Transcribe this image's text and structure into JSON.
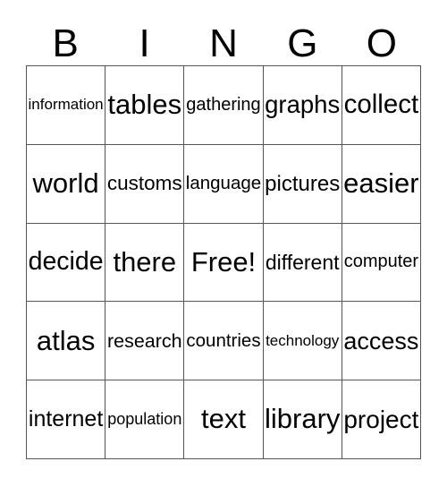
{
  "card": {
    "header_letters": [
      "B",
      "I",
      "N",
      "G",
      "O"
    ],
    "free_space_label": "Free!",
    "colors": {
      "text": "#000000",
      "grid_line": "#555555",
      "background": "#ffffff"
    },
    "rows": [
      [
        {
          "text": "information"
        },
        {
          "text": "tables"
        },
        {
          "text": "gathering"
        },
        {
          "text": "graphs"
        },
        {
          "text": "collect"
        }
      ],
      [
        {
          "text": "world"
        },
        {
          "text": "customs"
        },
        {
          "text": "language"
        },
        {
          "text": "pictures"
        },
        {
          "text": "easier"
        }
      ],
      [
        {
          "text": "decide"
        },
        {
          "text": "there"
        },
        {
          "text": "Free!"
        },
        {
          "text": "different"
        },
        {
          "text": "computer"
        }
      ],
      [
        {
          "text": "atlas"
        },
        {
          "text": "research"
        },
        {
          "text": "countries"
        },
        {
          "text": "technology"
        },
        {
          "text": "access"
        }
      ],
      [
        {
          "text": "internet"
        },
        {
          "text": "population"
        },
        {
          "text": "text"
        },
        {
          "text": "library"
        },
        {
          "text": "project"
        }
      ]
    ]
  }
}
